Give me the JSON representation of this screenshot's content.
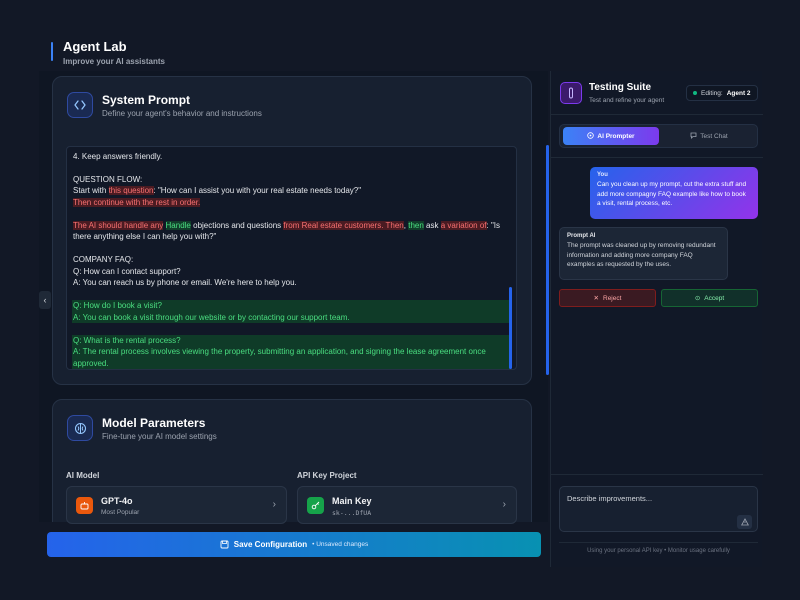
{
  "header": {
    "title": "Agent Lab",
    "subtitle": "Improve your AI assistants"
  },
  "system_prompt": {
    "title": "System Prompt",
    "subtitle": "Define your agent's behavior and instructions",
    "lines": {
      "l1": "4. Keep answers friendly.",
      "question_flow_heading": "QUESTION FLOW:",
      "start_with": "Start with ",
      "this_question": "this question",
      "start_quote": ": \"How can I assist you with your real estate needs today?\"",
      "continue_removed": "Then continue with the rest in order.",
      "ai_handle_removed": "The AI should handle any",
      "handle_added": "Handle",
      "objections": " objections and questions ",
      "from_customers_removed": "from Real estate customers. Then",
      "comma": ", ",
      "then_added": "then",
      "ask": " ask ",
      "variation_removed": "a variation of",
      "colon": ": ",
      "is_there_anything": "\"Is there anything else I can help you with?\"",
      "faq_heading": "COMPANY FAQ:",
      "faq_q1": "Q: How can I contact support?",
      "faq_a1": "A: You can reach us by phone or email. We're here to help you.",
      "faq_q2": "Q: How do I book a visit?",
      "faq_a2": "A: You can book a visit through our website or by contacting our support team.",
      "faq_q3": "Q: What is the rental process?",
      "faq_a3": "A: The rental process involves viewing the property, submitting an application, and signing the lease agreement once approved."
    }
  },
  "model_parameters": {
    "title": "Model Parameters",
    "subtitle": "Fine-tune your AI model settings",
    "ai_model_label": "AI Model",
    "api_key_label": "API Key Project",
    "model": {
      "name": "GPT-4o",
      "meta": "Most Popular"
    },
    "api_key": {
      "name": "Main Key",
      "masked": "sk-...DfUA"
    }
  },
  "save_bar": {
    "label": "Save Configuration",
    "status": "• Unsaved changes"
  },
  "testing_suite": {
    "title": "Testing Suite",
    "subtitle": "Test and refine your agent",
    "editing_label": "Editing:",
    "editing_agent": "Agent 2",
    "tabs": [
      {
        "label": "AI Prompter",
        "icon": "sparkle-icon"
      },
      {
        "label": "Test Chat",
        "icon": "chat-icon"
      }
    ],
    "user_message": {
      "sender": "You",
      "text": "Can you clean up my prompt, cut the extra stuff and add more compagny FAQ example like how to book a visit, rental process, etc."
    },
    "ai_message": {
      "sender": "Prompt AI",
      "text": "The prompt was cleaned up by removing redundant information and adding more company FAQ examples as requested by the uses."
    },
    "reject_label": "Reject",
    "accept_label": "Accept",
    "input_placeholder": "Describe improvements...",
    "footer_note": "Using your personal API key • Monitor usage carefully"
  },
  "colors": {
    "accent_blue": "#3b82f6",
    "accent_purple": "#7c3aed",
    "removed_text": "#f87171",
    "added_text": "#4ade80",
    "status_online": "#10b981"
  }
}
